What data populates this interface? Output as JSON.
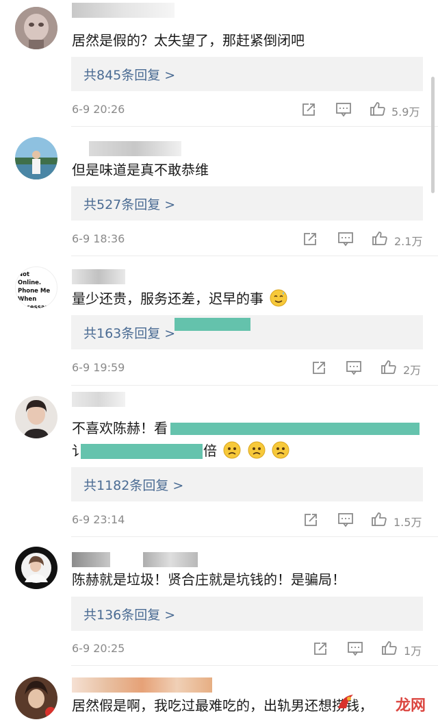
{
  "comments": [
    {
      "text": "居然是假的？太失望了，那赶紧倒闭吧",
      "replies": "共845条回复 >",
      "time": "6-9 20:26",
      "likes": "5.9万"
    },
    {
      "text": "但是味道是真不敢恭维",
      "replies": "共527条回复 >",
      "time": "6-9 18:36",
      "likes": "2.1万"
    },
    {
      "text": "量少还贵，服务还差，迟早的事",
      "avatar_text": "Not Online. Phone Me When Necessary.",
      "replies": "共163条回复 >",
      "time": "6-9 19:59",
      "likes": "2万"
    },
    {
      "text": "不喜欢陈赫！看",
      "text2_start": "讠",
      "text2_end": "倍",
      "replies": "共1182条回复 >",
      "time": "6-9 23:14",
      "likes": "1.5万"
    },
    {
      "text": "陈赫就是垃圾！贤合庄就是坑钱的！是骗局！",
      "replies": "共136条回复 >",
      "time": "6-9 20:25",
      "likes": "1万"
    },
    {
      "text": "居然假是啊，我吃过最难吃的，出轨男还想捞钱，"
    }
  ],
  "watermark": "龙网",
  "colors": {
    "link": "#4a6b93",
    "meta": "#8a8a8a",
    "reply_bg": "#f2f2f2",
    "redaction": "#58bea6"
  },
  "icons": [
    "share-icon",
    "comment-icon",
    "like-icon",
    "sad-emoji-icon",
    "sweat-emoji-icon"
  ]
}
